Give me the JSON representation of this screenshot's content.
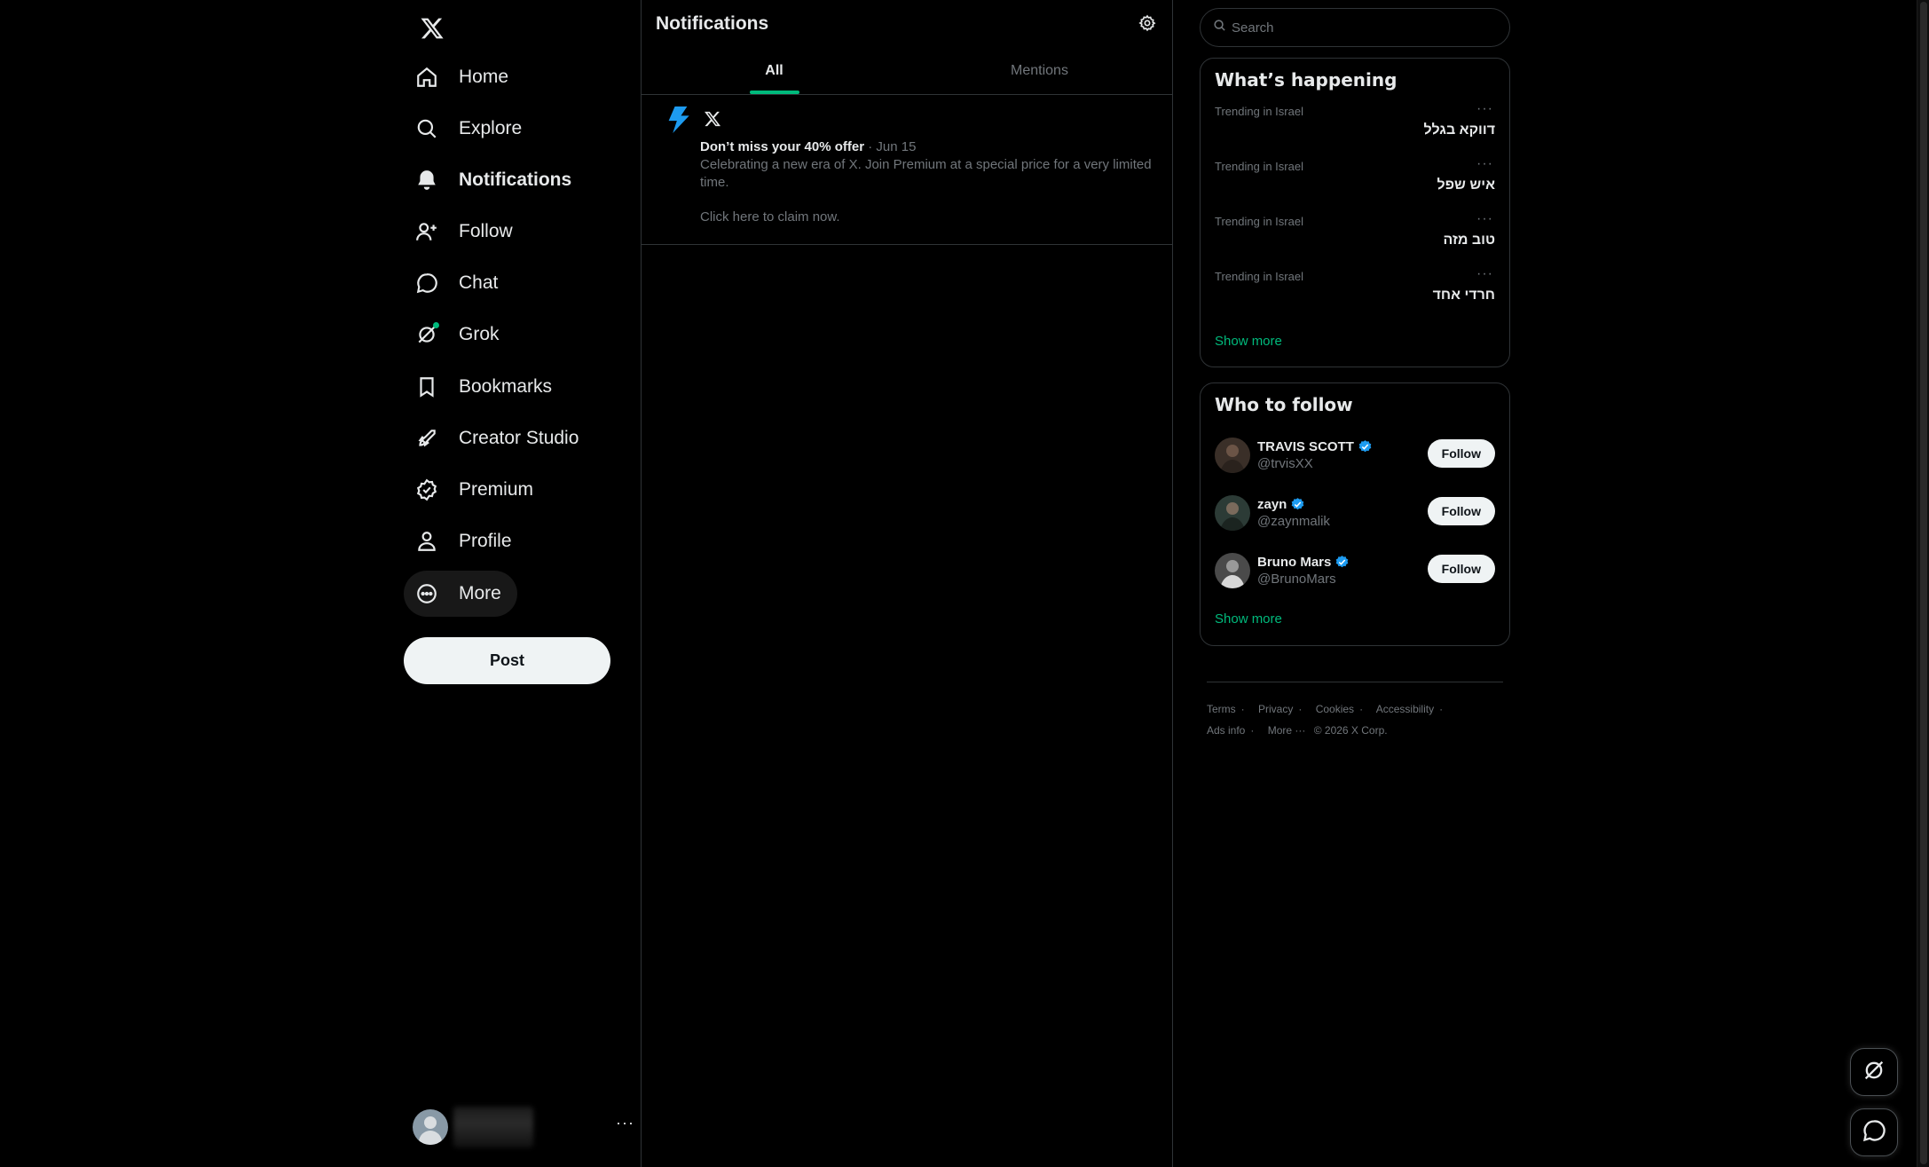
{
  "nav": {
    "items": [
      {
        "label": "Home",
        "icon": "home-icon"
      },
      {
        "label": "Explore",
        "icon": "search-icon"
      },
      {
        "label": "Notifications",
        "icon": "bell-icon"
      },
      {
        "label": "Follow",
        "icon": "add-person-icon"
      },
      {
        "label": "Chat",
        "icon": "chat-bubble-icon"
      },
      {
        "label": "Grok",
        "icon": "grok-icon"
      },
      {
        "label": "Bookmarks",
        "icon": "bookmark-icon"
      },
      {
        "label": "Creator Studio",
        "icon": "rocket-icon"
      },
      {
        "label": "Premium",
        "icon": "verified-badge-icon"
      },
      {
        "label": "Profile",
        "icon": "person-icon"
      },
      {
        "label": "More",
        "icon": "more-circle-icon"
      }
    ],
    "active": "Notifications",
    "post_label": "Post",
    "account_more": "···"
  },
  "center": {
    "title": "Notifications",
    "tabs": [
      {
        "label": "All",
        "active": true
      },
      {
        "label": "Mentions",
        "active": false
      }
    ],
    "notification": {
      "headline": "Don’t miss your 40% offer",
      "date": " · Jun 15",
      "body": "Celebrating a new era of X. Join Premium at a special price for a very limited time.",
      "cta": "Click here to claim now."
    }
  },
  "right": {
    "search": {
      "placeholder": "Search"
    },
    "trending": {
      "title": "What’s happening",
      "items": [
        {
          "context": "Trending in Israel",
          "name": "דווקא בגלל"
        },
        {
          "context": "Trending in Israel",
          "name": "איש שפל"
        },
        {
          "context": "Trending in Israel",
          "name": "טוב מזה"
        },
        {
          "context": "Trending in Israel",
          "name": "חרדי אחד"
        }
      ],
      "dots": "···",
      "show_more": "Show more"
    },
    "who_to_follow": {
      "title": "Who to follow",
      "items": [
        {
          "name": "TRAVIS SCOTT",
          "handle": "@trvisXX",
          "follow_label": "Follow"
        },
        {
          "name": "zayn",
          "handle": "@zaynmalik",
          "follow_label": "Follow"
        },
        {
          "name": "Bruno Mars",
          "handle": "@BrunoMars",
          "follow_label": "Follow"
        }
      ],
      "show_more": "Show more"
    },
    "footer": {
      "links": [
        "Terms",
        "Privacy",
        "Cookies",
        "Accessibility",
        "Ads info",
        "More ···"
      ],
      "copyright": "© 2026 X Corp."
    }
  },
  "colors": {
    "accent": "#00ba7c",
    "verified": "#1d9bf0",
    "border": "#2f3336",
    "muted": "#71767b",
    "bolt": "#1d9bf0"
  }
}
